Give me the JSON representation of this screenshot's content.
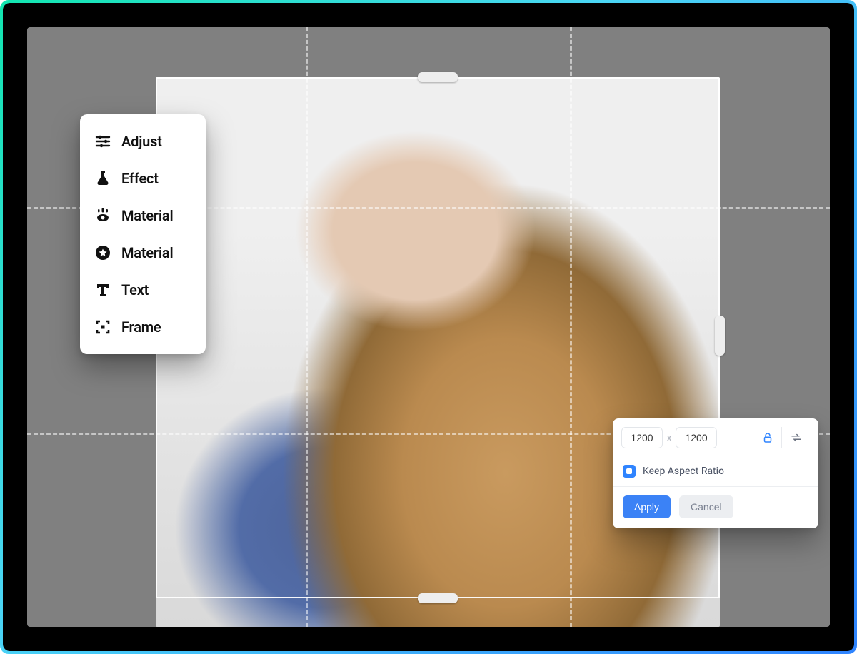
{
  "sidebar": {
    "items": [
      {
        "label": "Adjust",
        "icon": "sliders-icon"
      },
      {
        "label": "Effect",
        "icon": "flask-icon"
      },
      {
        "label": "Material",
        "icon": "eye-sparkle-icon"
      },
      {
        "label": "Material",
        "icon": "star-circle-icon"
      },
      {
        "label": "Text",
        "icon": "text-icon"
      },
      {
        "label": "Frame",
        "icon": "frame-icon"
      }
    ]
  },
  "sizePanel": {
    "width_value": "1200",
    "height_value": "1200",
    "x_label": "x",
    "lock_icon": "lock-icon",
    "swap_icon": "swap-horizontal-icon",
    "keep_aspect_label": "Keep Aspect Ratio",
    "keep_aspect_checked": true,
    "apply_label": "Apply",
    "cancel_label": "Cancel"
  },
  "crop": {
    "guides": {
      "vertical": 2,
      "horizontal": 2
    },
    "handles": [
      "top",
      "right",
      "bottom"
    ]
  },
  "colors": {
    "accent": "#3b82f6",
    "canvas_bg": "#808080",
    "border_gradient": [
      "#12e6b0",
      "#4bd6f5",
      "#2f84ff"
    ]
  }
}
